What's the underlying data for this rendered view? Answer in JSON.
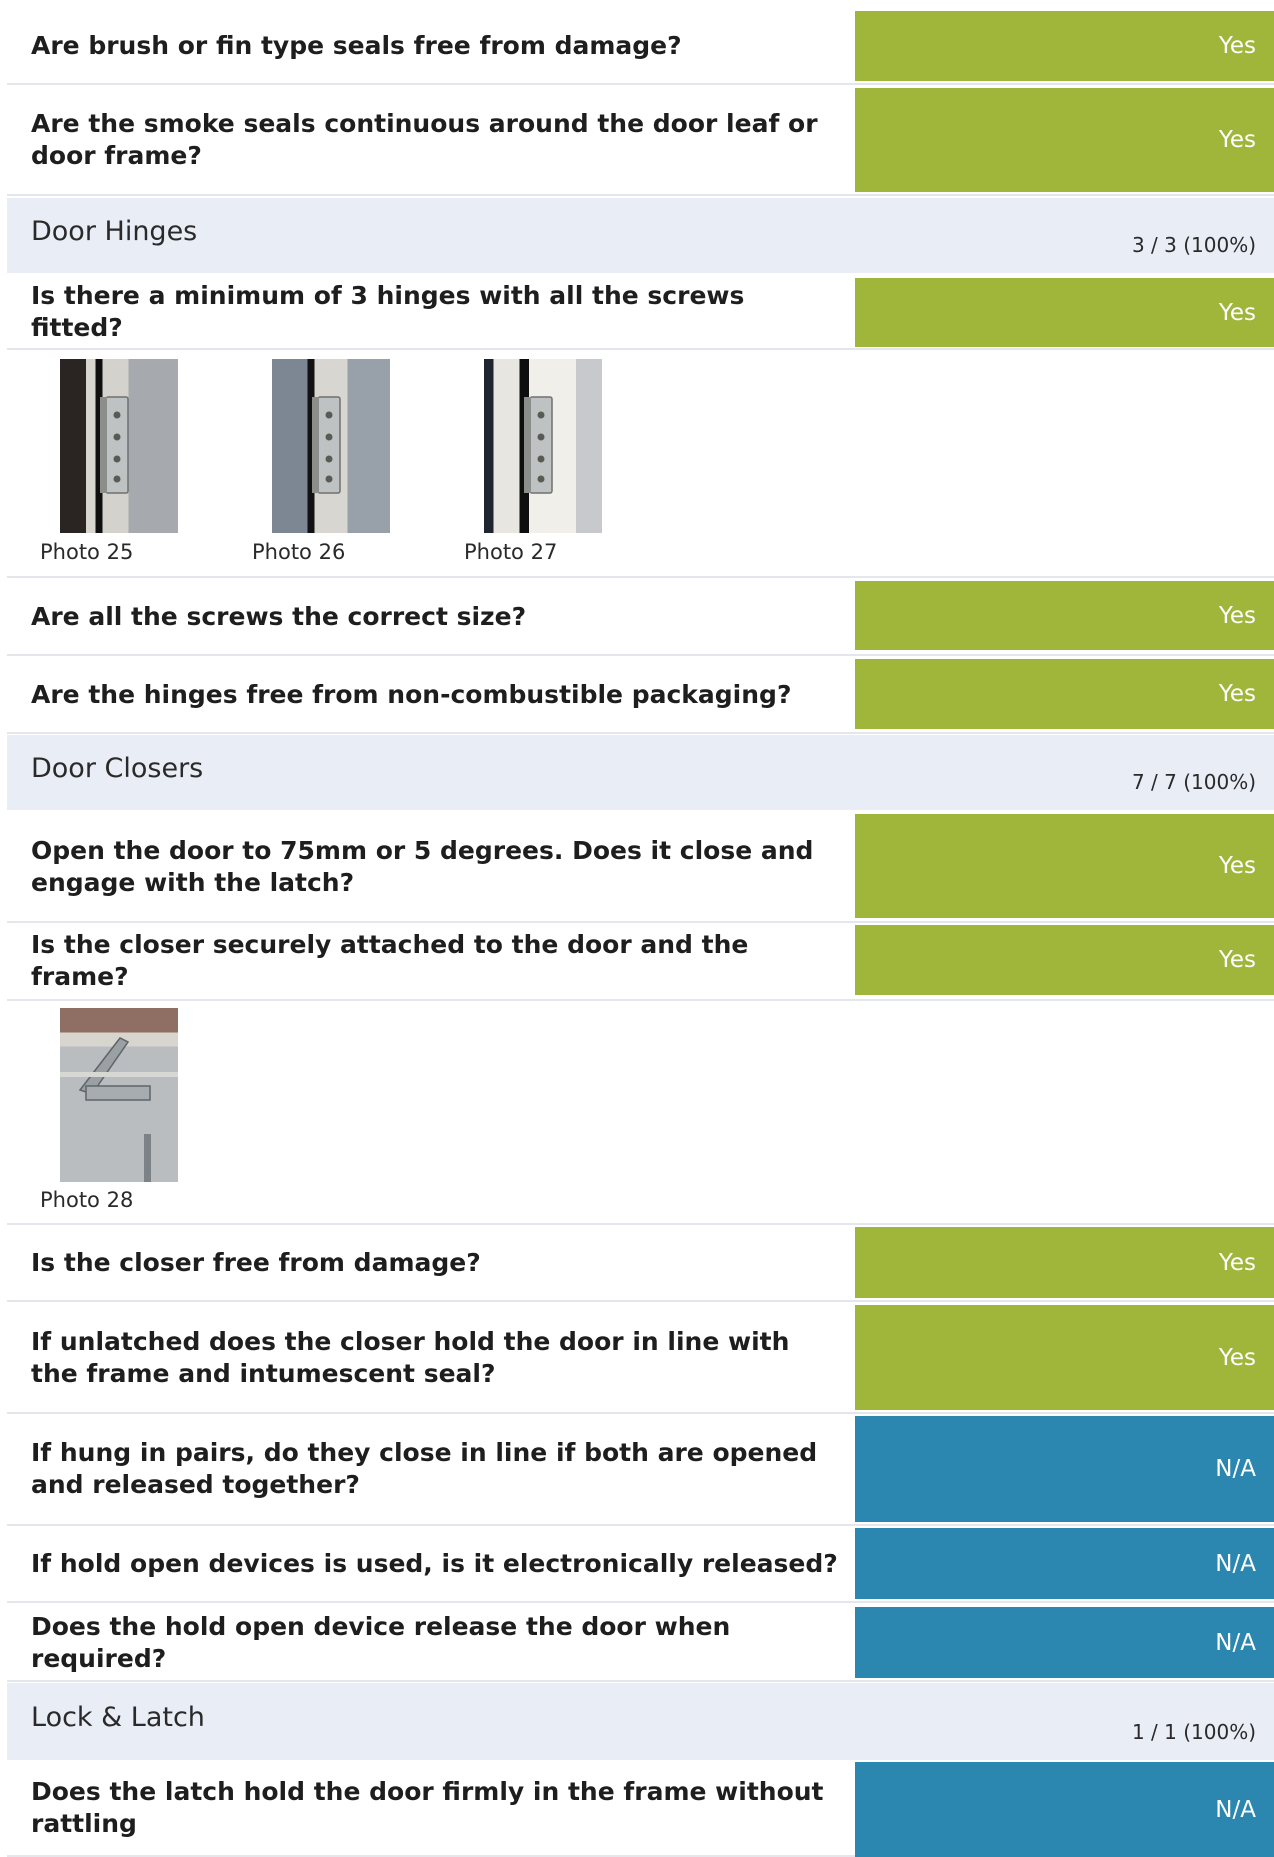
{
  "items": [
    {
      "question": "Are brush or fin type seals free from damage?",
      "answer": "Yes"
    },
    {
      "question": "Are the smoke seals continuous around the door leaf or door frame?",
      "answer": "Yes"
    },
    {
      "section": "Door Hinges",
      "score": "3 / 3 (100%)"
    },
    {
      "question": "Is there a minimum of 3 hinges with all the screws fitted?",
      "answer": "Yes"
    },
    {
      "photos": [
        "Photo 25",
        "Photo 26",
        "Photo 27"
      ]
    },
    {
      "question": "Are all the screws the correct size?",
      "answer": "Yes"
    },
    {
      "question": "Are the hinges free from non-combustible packaging?",
      "answer": "Yes"
    },
    {
      "section": "Door Closers",
      "score": "7 / 7 (100%)"
    },
    {
      "question": "Open the door to 75mm or 5 degrees. Does it close and engage with the latch?",
      "answer": "Yes"
    },
    {
      "question": "Is the closer securely attached to the door and the frame?",
      "answer": "Yes"
    },
    {
      "photos": [
        "Photo 28"
      ]
    },
    {
      "question": "Is the closer free from damage?",
      "answer": "Yes"
    },
    {
      "question": "If unlatched does the closer hold the door in line with the frame and intumescent seal?",
      "answer": "Yes"
    },
    {
      "question": "If hung in pairs, do they close in line if both are opened and released together?",
      "answer": "N/A"
    },
    {
      "question": "If hold open devices is used, is it electronically released?",
      "answer": "N/A"
    },
    {
      "question": "Does the hold open device release the door when required?",
      "answer": "N/A"
    },
    {
      "section": "Lock & Latch",
      "score": "1 / 1 (100%)"
    },
    {
      "question": "Does the latch hold the door firmly in the frame without rattling",
      "answer": "N/A"
    }
  ],
  "colors": {
    "yes": "#a0b63b",
    "na": "#2b86b0",
    "section_bg": "#e9edf5",
    "divider": "#e3e6ec"
  }
}
